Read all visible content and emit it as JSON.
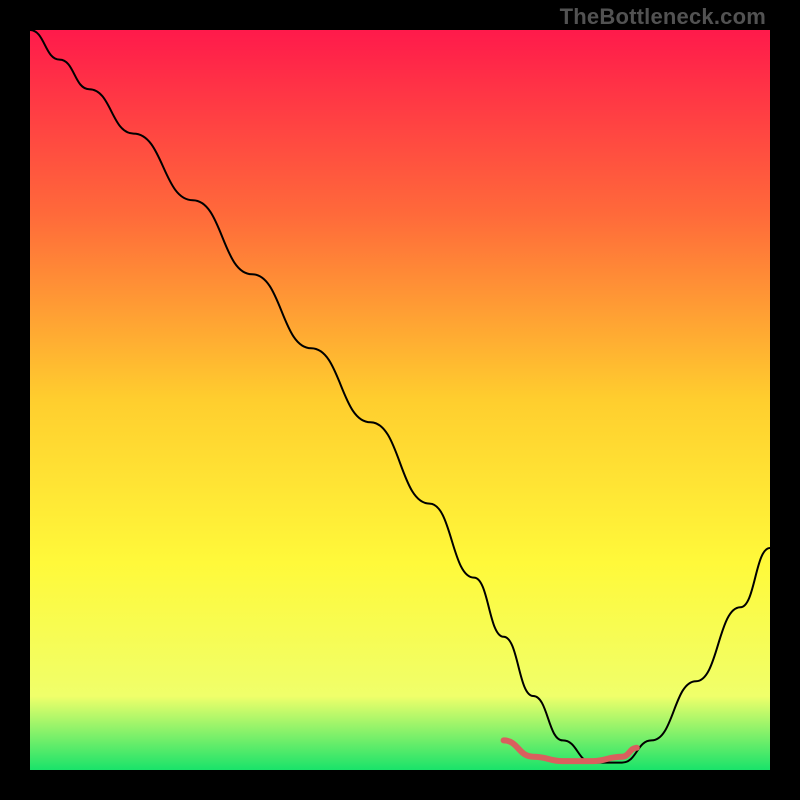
{
  "chart_data": {
    "type": "line",
    "watermark": "TheBottleneck.com",
    "xlim": [
      0,
      100
    ],
    "ylim": [
      0,
      100
    ],
    "gradient_stops": [
      {
        "offset": 0,
        "color": "#ff1a4b"
      },
      {
        "offset": 25,
        "color": "#ff6a3a"
      },
      {
        "offset": 50,
        "color": "#ffce2e"
      },
      {
        "offset": 72,
        "color": "#fff93a"
      },
      {
        "offset": 90,
        "color": "#f0ff6a"
      },
      {
        "offset": 100,
        "color": "#19e36a"
      }
    ],
    "series": [
      {
        "name": "bottleneck-curve",
        "color": "#000000",
        "width": 2,
        "x": [
          0,
          4,
          8,
          14,
          22,
          30,
          38,
          46,
          54,
          60,
          64,
          68,
          72,
          76,
          80,
          84,
          90,
          96,
          100
        ],
        "y": [
          100,
          96,
          92,
          86,
          77,
          67,
          57,
          47,
          36,
          26,
          18,
          10,
          4,
          1,
          1,
          4,
          12,
          22,
          30
        ]
      }
    ],
    "valley_band": {
      "color": "#d9605e",
      "width": 6,
      "x": [
        64,
        68,
        72,
        76,
        80,
        82
      ],
      "y": [
        4,
        1.8,
        1.2,
        1.2,
        1.8,
        3
      ]
    }
  }
}
